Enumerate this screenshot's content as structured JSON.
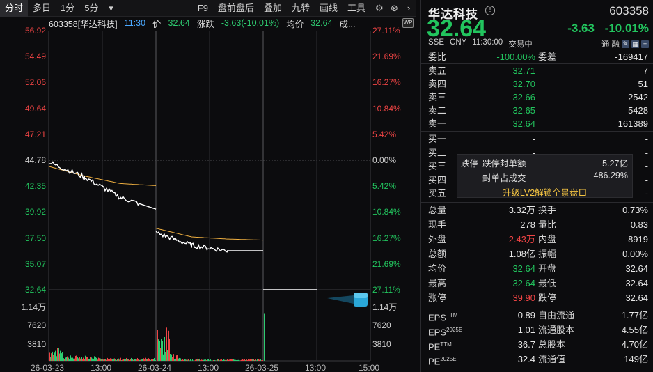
{
  "toolbar": {
    "tabs": [
      "分时",
      "多日",
      "1分",
      "5分"
    ],
    "dropdown_icon": "menu-arrow-icon",
    "items": [
      "F9",
      "盘前盘后",
      "叠加",
      "九转",
      "画线",
      "工具"
    ],
    "icons": [
      "gear-icon",
      "close-icon",
      "chevron-right-icon"
    ]
  },
  "infobar": {
    "name": "603358[华达科技]",
    "time": "11:30",
    "price_label": "价",
    "price": "32.64",
    "change_label": "涨跌",
    "change": "-3.63(-10.01%)",
    "avg_label": "均价",
    "avg": "32.64",
    "vol_label": "成..."
  },
  "badge": "WP",
  "price_axis": {
    "left": [
      "56.92",
      "54.49",
      "52.06",
      "49.64",
      "47.21",
      "44.78",
      "42.35",
      "39.92",
      "37.50",
      "35.07",
      "32.64"
    ],
    "right": [
      "27.11%",
      "21.69%",
      "16.27%",
      "10.84%",
      "5.42%",
      "0.00%",
      "5.42%",
      "10.84%",
      "16.27%",
      "21.69%",
      "27.11%"
    ]
  },
  "volume_axis": {
    "left": [
      "1.14万",
      "7620",
      "3810"
    ],
    "right": [
      "1.14万",
      "7620",
      "3810"
    ]
  },
  "x_axis": [
    "26-03-23",
    "13:00",
    "26-03-24",
    "13:00",
    "26-03-25",
    "13:00",
    "15:00"
  ],
  "chart_data": {
    "type": "line",
    "title": "603358[华达科技]",
    "x": [
      "26-03-23 09:30",
      "26-03-23 11:30",
      "26-03-23 13:00",
      "26-03-23 15:00",
      "26-03-24 09:30",
      "26-03-24 11:30",
      "26-03-24 13:00",
      "26-03-24 15:00",
      "26-03-25 09:30",
      "26-03-25 11:30"
    ],
    "ylim": [
      32.64,
      56.92
    ],
    "series": [
      {
        "name": "",
        "values": [
          44.6,
          43.2,
          41.3,
          40.2,
          38.0,
          36.8,
          36.3,
          36.3,
          32.64,
          32.64
        ]
      },
      {
        "name": "",
        "values": [
          44.2,
          43.3,
          42.6,
          42.4,
          38.4,
          37.6,
          37.4,
          37.3,
          32.64,
          32.64
        ]
      }
    ],
    "volume": {
      "ylim": [
        0,
        15200
      ],
      "peak": 11400
    }
  },
  "right": {
    "name": "华达科技",
    "code": "603358",
    "price": "32.64",
    "change": "-3.63",
    "change_pct": "-10.01%",
    "meta": [
      "SSE",
      "CNY",
      "11:30:00",
      "交易中"
    ],
    "flags": [
      "通",
      "融"
    ],
    "weibi_label": "委比",
    "weibi": "-100.00%",
    "weicha_label": "委差",
    "weicha": "-169417",
    "sells": [
      {
        "label": "卖五",
        "price": "32.71",
        "vol": "7"
      },
      {
        "label": "卖四",
        "price": "32.70",
        "vol": "51"
      },
      {
        "label": "卖三",
        "price": "32.66",
        "vol": "2542"
      },
      {
        "label": "卖二",
        "price": "32.65",
        "vol": "5428"
      },
      {
        "label": "卖一",
        "price": "32.64",
        "vol": "161389"
      }
    ],
    "buys": [
      {
        "label": "买一",
        "price": "-",
        "vol": "-"
      },
      {
        "label": "买二",
        "price": "-",
        "vol": "-"
      },
      {
        "label": "买三",
        "price": "-",
        "vol": "-"
      },
      {
        "label": "买四",
        "price": "-",
        "vol": "-"
      },
      {
        "label": "买五",
        "price": "-",
        "vol": "-"
      }
    ],
    "stats": [
      {
        "l1": "总量",
        "v1": "3.32万",
        "c1": "w",
        "l2": "换手",
        "v2": "0.73%",
        "c2": "w"
      },
      {
        "l1": "现手",
        "v1": "278",
        "c1": "w",
        "l2": "量比",
        "v2": "0.83",
        "c2": "w"
      },
      {
        "l1": "外盘",
        "v1": "2.43万",
        "c1": "r",
        "l2": "内盘",
        "v2": "8919",
        "c2": "g"
      },
      {
        "l1": "总额",
        "v1": "1.08亿",
        "c1": "w",
        "l2": "振幅",
        "v2": "0.00%",
        "c2": "w"
      },
      {
        "l1": "均价",
        "v1": "32.64",
        "c1": "g",
        "l2": "开盘",
        "v2": "32.64",
        "c2": "g"
      },
      {
        "l1": "最高",
        "v1": "32.64",
        "c1": "g",
        "l2": "最低",
        "v2": "32.64",
        "c2": "g"
      },
      {
        "l1": "涨停",
        "v1": "39.90",
        "c1": "r",
        "l2": "跌停",
        "v2": "32.64",
        "c2": "g"
      }
    ],
    "fin": [
      {
        "l1": "EPS",
        "s1": "TTM",
        "v1": "0.89",
        "l2": "自由流通",
        "v2": "1.77亿"
      },
      {
        "l1": "EPS",
        "s1": "2025E",
        "v1": "1.01",
        "l2": "流通股本",
        "v2": "4.55亿"
      },
      {
        "l1": "PE",
        "s1": "TTM",
        "v1": "36.7",
        "l2": "总股本",
        "v2": "4.70亿"
      },
      {
        "l1": "PE",
        "s1": "2025E",
        "v1": "32.4",
        "l2": "流通值",
        "v2": "149亿"
      }
    ],
    "popup": {
      "tag": "跌停",
      "seal_label": "跌停封单额",
      "seal_value": "5.27亿",
      "ratio_label": "封单占成交",
      "ratio_value": "486.29%",
      "upgrade": "升级LV2解锁全景盘口"
    }
  }
}
